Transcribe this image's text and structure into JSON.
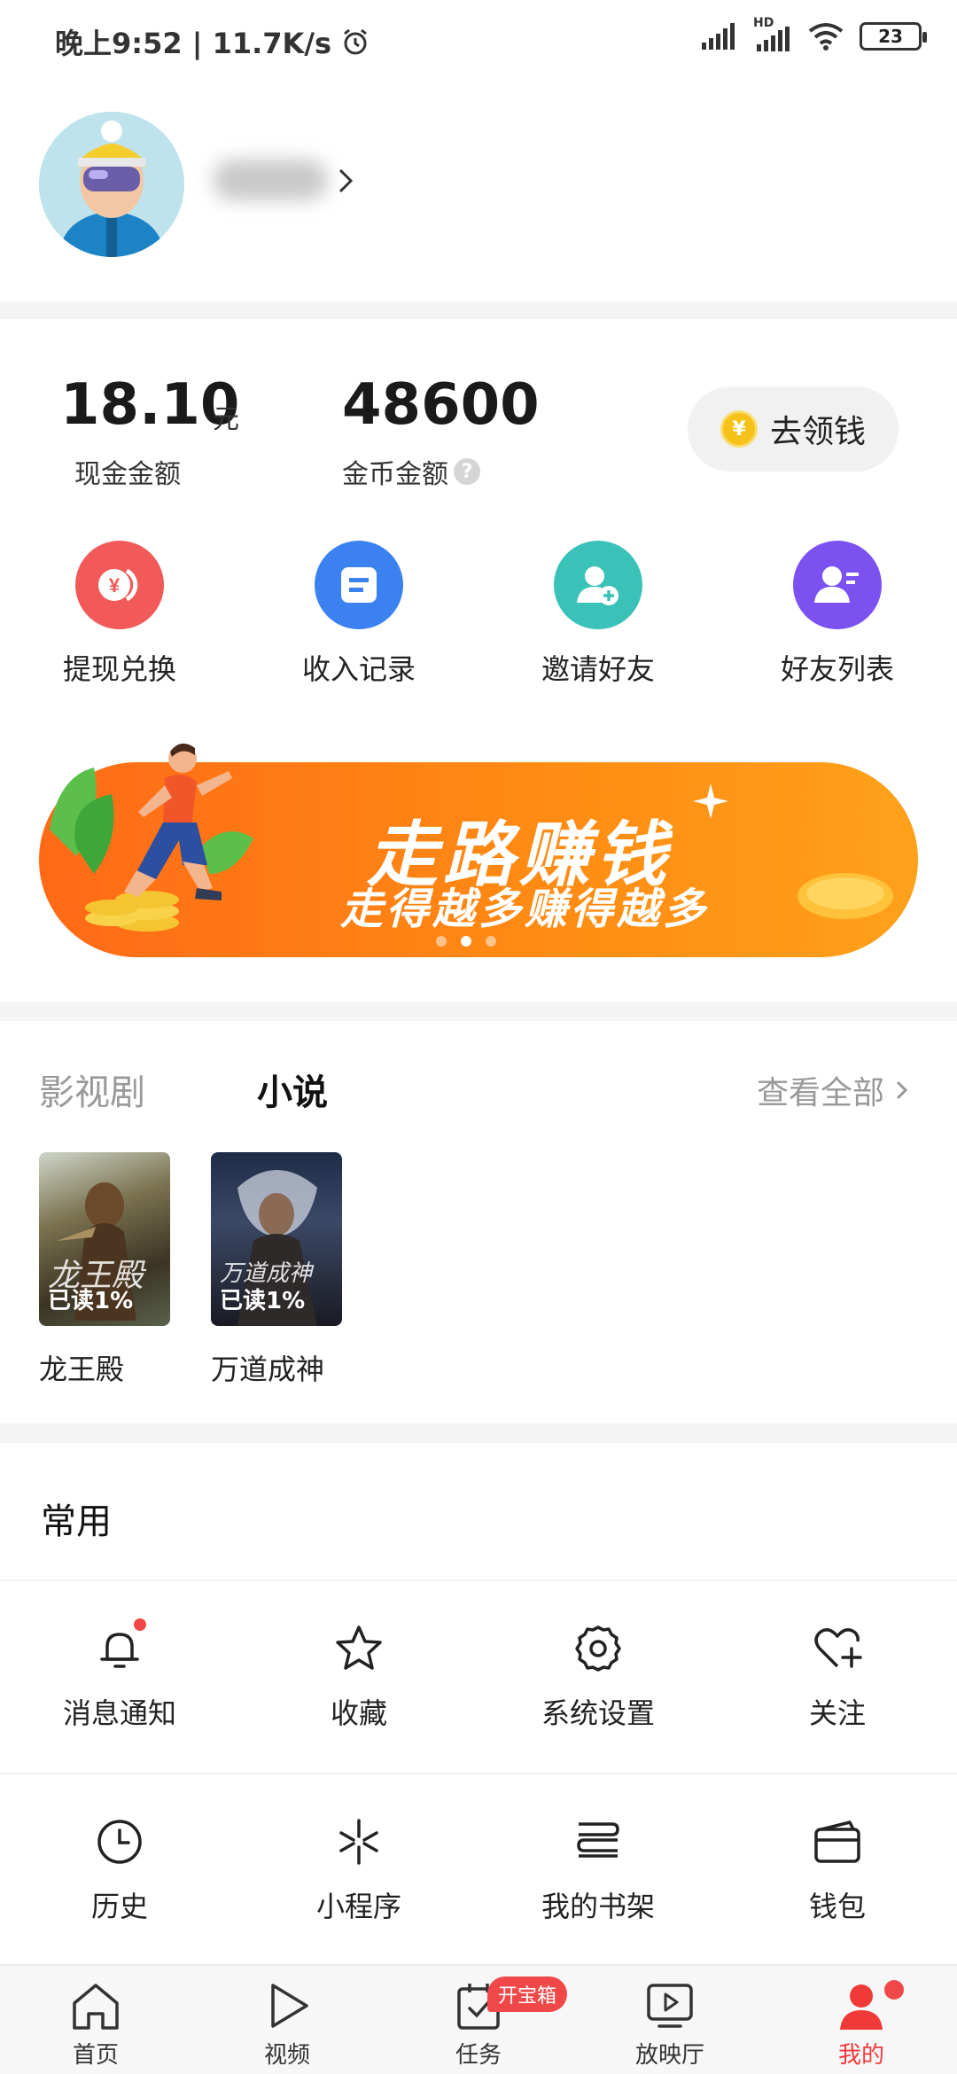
{
  "status_bar": {
    "time_speed": "晚上9:52 | 11.7K/s",
    "network_hd": "HD",
    "battery": "23"
  },
  "profile": {
    "avatar_icon": "skier-avatar",
    "arrow_icon": "chevron-right-icon"
  },
  "wallet": {
    "cash_amount": "18.10",
    "cash_unit": "元",
    "cash_label": "现金金额",
    "coin_amount": "48600",
    "coin_label": "金币金额",
    "help_icon": "?",
    "collect_label": "去领钱",
    "collect_coin_symbol": "¥"
  },
  "quick_actions": [
    {
      "label": "提现兑换",
      "icon": "coin-exchange-icon",
      "color": "#f25a5a"
    },
    {
      "label": "收入记录",
      "icon": "document-icon",
      "color": "#3b82f0"
    },
    {
      "label": "邀请好友",
      "icon": "add-friend-icon",
      "color": "#3bc2b8"
    },
    {
      "label": "好友列表",
      "icon": "friend-list-icon",
      "color": "#7b52f0"
    }
  ],
  "banner": {
    "title": "走路赚钱",
    "subtitle": "走得越多赚得越多",
    "page_count": 3,
    "active_page": 1
  },
  "media": {
    "tab_movie": "影视剧",
    "tab_novel": "小说",
    "view_all": "查看全部",
    "books": [
      {
        "title": "龙王殿",
        "progress": "已读1%",
        "cover_text": "龙王殿"
      },
      {
        "title": "万道成神",
        "progress": "已读1%",
        "cover_text": "万道成神"
      }
    ]
  },
  "common": {
    "title": "常用",
    "row1": [
      {
        "label": "消息通知",
        "icon": "bell-icon",
        "dot": true
      },
      {
        "label": "收藏",
        "icon": "star-icon"
      },
      {
        "label": "系统设置",
        "icon": "gear-icon"
      },
      {
        "label": "关注",
        "icon": "heart-plus-icon"
      }
    ],
    "row2": [
      {
        "label": "历史",
        "icon": "clock-icon"
      },
      {
        "label": "小程序",
        "icon": "mini-program-icon"
      },
      {
        "label": "我的书架",
        "icon": "bookshelf-icon"
      },
      {
        "label": "钱包",
        "icon": "wallet-icon"
      }
    ]
  },
  "bottom_nav": [
    {
      "label": "首页",
      "icon": "home-icon"
    },
    {
      "label": "视频",
      "icon": "play-icon"
    },
    {
      "label": "任务",
      "icon": "task-icon",
      "badge": "开宝箱"
    },
    {
      "label": "放映厅",
      "icon": "screening-room-icon"
    },
    {
      "label": "我的",
      "icon": "user-icon",
      "active": true
    }
  ],
  "colors": {
    "accent_red": "#f03a3a",
    "banner_orange": "#ff7a14",
    "coin_gold": "#f6c21a"
  }
}
